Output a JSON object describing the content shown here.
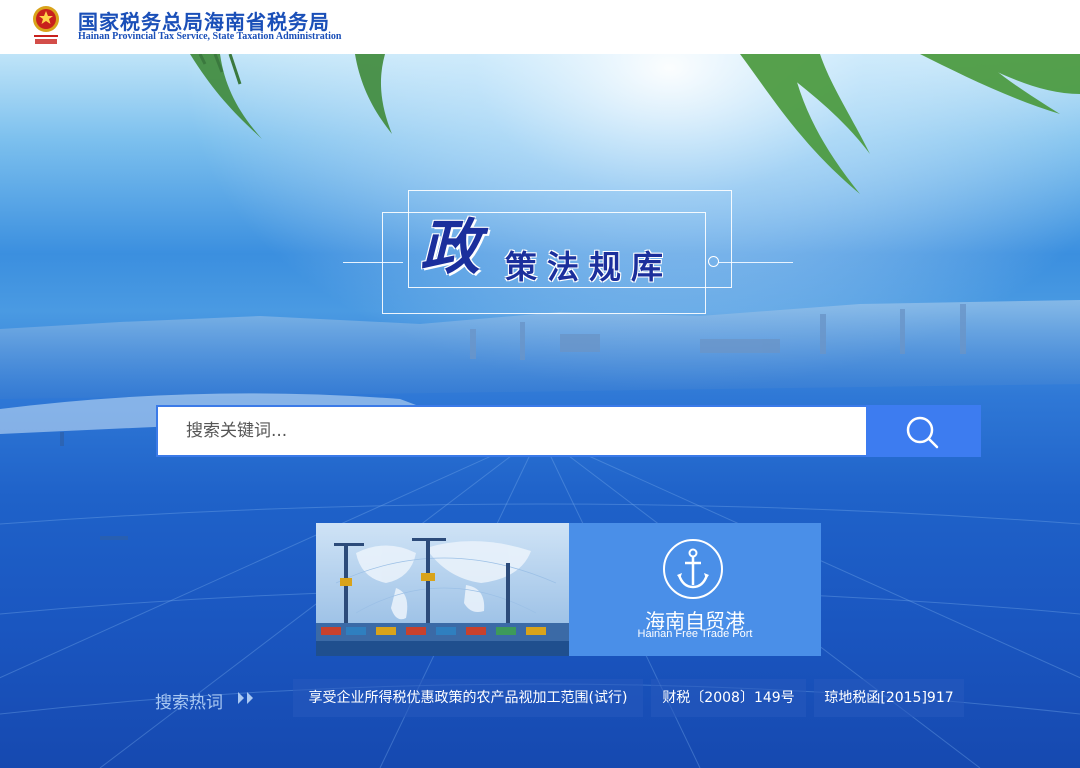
{
  "header": {
    "org_name_cn": "国家税务总局海南省税务局",
    "org_name_en": "Hainan Provincial Tax Service, State Taxation Administration"
  },
  "title": {
    "big_char": "政",
    "rest": "策法规库"
  },
  "search": {
    "placeholder": "搜索关键词..."
  },
  "banner": {
    "title_cn": "海南自贸港",
    "title_en": "Hainan Free Trade Port"
  },
  "hot_search": {
    "label": "搜索热词",
    "tags": [
      "享受企业所得税优惠政策的农产品视加工范围(试行)",
      "财税〔2008〕149号",
      "琼地税函[2015]917"
    ]
  },
  "colors": {
    "brand_blue": "#1a4fb8",
    "search_button": "#3d7cf0",
    "banner_side": "#4a8fe8"
  }
}
